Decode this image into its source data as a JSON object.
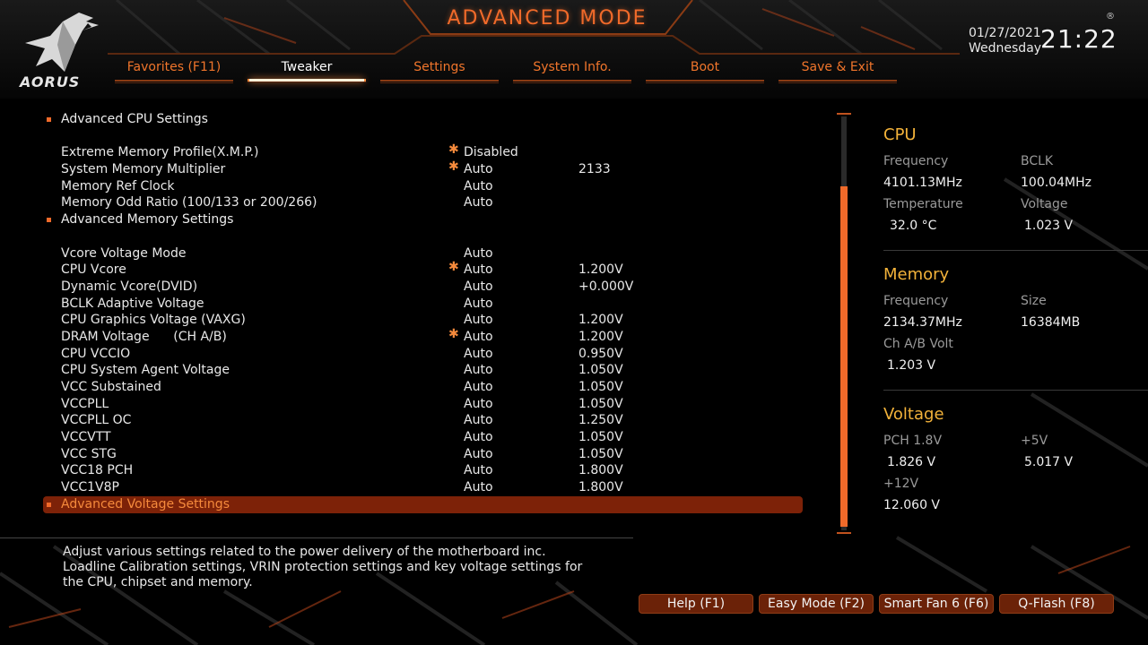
{
  "header": {
    "title": "ADVANCED MODE",
    "logo_text": "AORUS",
    "date": "01/27/2021",
    "weekday": "Wednesday",
    "time": "21:22",
    "registered_mark": "®"
  },
  "tabs": [
    {
      "label": "Favorites (F11)",
      "active": false
    },
    {
      "label": "Tweaker",
      "active": true
    },
    {
      "label": "Settings",
      "active": false
    },
    {
      "label": "System Info.",
      "active": false
    },
    {
      "label": "Boot",
      "active": false
    },
    {
      "label": "Save & Exit",
      "active": false
    }
  ],
  "settings": {
    "advanced_cpu": "Advanced CPU Settings",
    "xmp": {
      "name": "Extreme Memory Profile(X.M.P.)",
      "value": "Disabled"
    },
    "mem_mult": {
      "name": "System Memory Multiplier",
      "value": "Auto",
      "current": "2133"
    },
    "mem_ref": {
      "name": "Memory Ref Clock",
      "value": "Auto"
    },
    "mem_odd": {
      "name": "Memory Odd Ratio (100/133 or 200/266)",
      "value": "Auto"
    },
    "advanced_mem": "Advanced Memory Settings",
    "vcore_mode": {
      "name": "Vcore Voltage Mode",
      "value": "Auto"
    },
    "cpu_vcore": {
      "name": "CPU Vcore",
      "value": "Auto",
      "current": "1.200V"
    },
    "dyn_vcore": {
      "name": "Dynamic Vcore(DVID)",
      "value": "Auto",
      "current": "+0.000V"
    },
    "bclk_adapt": {
      "name": "BCLK Adaptive Voltage",
      "value": "Auto"
    },
    "cpu_gfx": {
      "name": "CPU Graphics Voltage (VAXG)",
      "value": "Auto",
      "current": "1.200V"
    },
    "dram_v": {
      "name": "DRAM Voltage      (CH A/B)",
      "value": "Auto",
      "current": "1.200V"
    },
    "cpu_vccio": {
      "name": "CPU VCCIO",
      "value": "Auto",
      "current": "0.950V"
    },
    "cpu_sa": {
      "name": "CPU System Agent Voltage",
      "value": "Auto",
      "current": "1.050V"
    },
    "vcc_sus": {
      "name": "VCC Substained",
      "value": "Auto",
      "current": "1.050V"
    },
    "vccpll": {
      "name": "VCCPLL",
      "value": "Auto",
      "current": "1.050V"
    },
    "vccpll_oc": {
      "name": "VCCPLL OC",
      "value": "Auto",
      "current": "1.250V"
    },
    "vccvtt": {
      "name": "VCCVTT",
      "value": "Auto",
      "current": "1.050V"
    },
    "vcc_stg": {
      "name": "VCC STG",
      "value": "Auto",
      "current": "1.050V"
    },
    "vcc18_pch": {
      "name": "VCC18 PCH",
      "value": "Auto",
      "current": "1.800V"
    },
    "vcc1v8p": {
      "name": "VCC1V8P",
      "value": "Auto",
      "current": "1.800V"
    },
    "advanced_volt": "Advanced Voltage Settings"
  },
  "help_text": "Adjust various settings related to the power delivery of the motherboard inc. Loadline Calibration settings, VRIN protection settings and key voltage settings for the CPU, chipset and memory.",
  "panel": {
    "cpu": {
      "title": "CPU",
      "frequency_label": "Frequency",
      "frequency": "4101.13MHz",
      "bclk_label": "BCLK",
      "bclk": "100.04MHz",
      "temp_label": "Temperature",
      "temp": "32.0 °C",
      "voltage_label": "Voltage",
      "voltage": "1.023 V"
    },
    "memory": {
      "title": "Memory",
      "frequency_label": "Frequency",
      "frequency": "2134.37MHz",
      "size_label": "Size",
      "size": "16384MB",
      "chab_label": "Ch A/B Volt",
      "chab": "1.203 V"
    },
    "voltage": {
      "title": "Voltage",
      "pch_label": "PCH 1.8V",
      "pch": "1.826 V",
      "p5_label": "+5V",
      "p5": "5.017 V",
      "p12_label": "+12V",
      "p12": "12.060 V"
    }
  },
  "buttons": {
    "help": "Help (F1)",
    "easy": "Easy Mode (F2)",
    "fan": "Smart Fan 6 (F6)",
    "qflash": "Q-Flash (F8)"
  },
  "colors": {
    "accent": "#f06a2a",
    "panel_title": "#f2b23a",
    "highlight_row": "#7d2208"
  },
  "icons": {
    "logo": "aorus-eagle-icon",
    "modified_marker": "asterisk-icon"
  }
}
